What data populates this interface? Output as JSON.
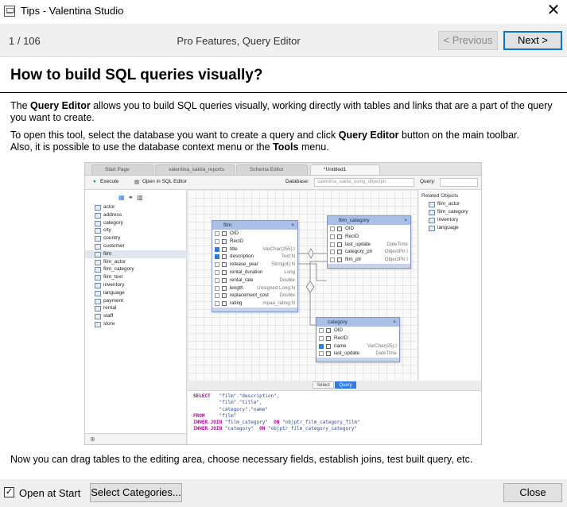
{
  "window": {
    "title": "Tips - Valentina Studio"
  },
  "nav": {
    "counter": "1 / 106",
    "tip_title": "Pro Features, Query Editor",
    "prev_label": "< Previous",
    "next_label": "Next >"
  },
  "content": {
    "heading": "How to build SQL queries visually?",
    "p1_a": "The ",
    "p1_b": "Query Editor",
    "p1_c": " allows you to build SQL queries visually, working directly with tables and links that are a part of the query you want to create.",
    "p2_a": "To open this tool, select the database you want to create a query and click ",
    "p2_b": "Query Editor",
    "p2_c": " button on the main toolbar.",
    "p2_d": "Also, it is possible to use the database context menu or the ",
    "p2_e": "Tools",
    "p2_f": " menu.",
    "p3": "Now you can drag tables to the editing area, choose necessary fields, establish joins, test built query, etc."
  },
  "screenshot": {
    "tabs": [
      "Start Page",
      "valentina_sakila_reports",
      "Schema Editor",
      "*Untitled1"
    ],
    "toolbar": {
      "execute": "Execute",
      "open_sql": "Open in SQL Editor",
      "database_label": "Database:",
      "database_value": "valentina_sakila_using_objectptr",
      "query_label": "Query:"
    },
    "tables_list": [
      "actor",
      "address",
      "category",
      "city",
      "country",
      "customer",
      "film",
      "film_actor",
      "film_category",
      "film_text",
      "inventory",
      "language",
      "payment",
      "rental",
      "staff",
      "store"
    ],
    "related_title": "Related Objects",
    "related": [
      "film_actor",
      "film_category",
      "inventory",
      "language"
    ],
    "film_table": {
      "name": "film",
      "rows": [
        {
          "n": "OID",
          "t": ""
        },
        {
          "n": "RecID",
          "t": ""
        },
        {
          "n": "title",
          "t": "VarChar(255):I"
        },
        {
          "n": "description",
          "t": "Text:N"
        },
        {
          "n": "release_year",
          "t": "String(4):N"
        },
        {
          "n": "rental_duration",
          "t": "Long"
        },
        {
          "n": "rental_rate",
          "t": "Double"
        },
        {
          "n": "length",
          "t": "Unsigned Long:N"
        },
        {
          "n": "replacement_cost",
          "t": "Double"
        },
        {
          "n": "rating",
          "t": "mpaa_rating:N"
        }
      ]
    },
    "film_category_table": {
      "name": "film_category",
      "rows": [
        {
          "n": "OID",
          "t": ""
        },
        {
          "n": "RecID",
          "t": ""
        },
        {
          "n": "last_update",
          "t": "DateTime"
        },
        {
          "n": "category_ptr",
          "t": "ObjectPtr:I"
        },
        {
          "n": "film_ptr",
          "t": "ObjectPtr:I"
        }
      ]
    },
    "category_table": {
      "name": "category",
      "rows": [
        {
          "n": "OID",
          "t": ""
        },
        {
          "n": "RecID",
          "t": ""
        },
        {
          "n": "name",
          "t": "VarChar(25):I"
        },
        {
          "n": "last_update",
          "t": "DateTime"
        }
      ]
    },
    "seg_select": "Select",
    "seg_query": "Query",
    "sql": {
      "l1_kw": "SELECT",
      "l1": "\"film\".\"description\",",
      "l2": "\"film\".\"title\",",
      "l3": "\"category\".\"name\"",
      "l4_kw": "FROM",
      "l4": "\"film\"",
      "l5_kw": "INNER JOIN",
      "l5a": "\"film_category\"",
      "l5_on": "ON",
      "l5b": "\"objptr_film_category_film\"",
      "l6_kw": "INNER JOIN",
      "l6a": "\"category\"",
      "l6_on": "ON",
      "l6b": "\"objptr_film_category_category\""
    }
  },
  "footer": {
    "open_at_start": "Open at Start",
    "select_categories": "Select Categories...",
    "close": "Close"
  }
}
